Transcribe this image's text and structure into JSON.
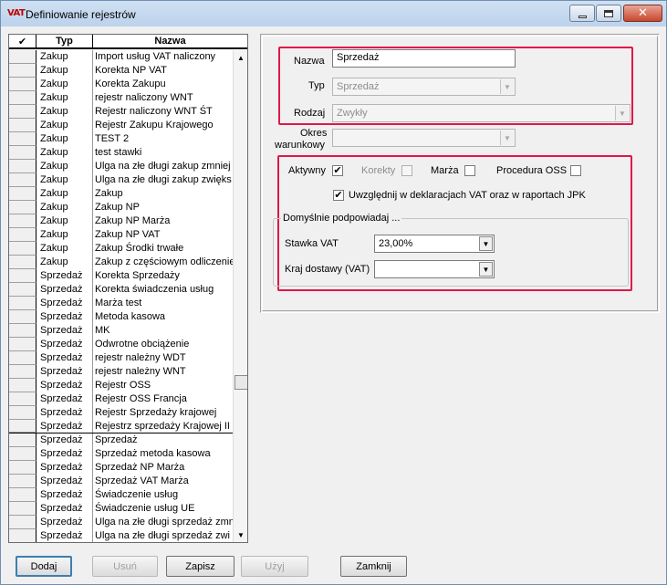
{
  "window": {
    "icon_text": "VAT",
    "title": "Definiowanie rejestrów"
  },
  "grid": {
    "headers": {
      "check": "✔",
      "typ": "Typ",
      "nazwa": "Nazwa"
    },
    "rows": [
      {
        "typ": "Zakup",
        "nazwa": "Import usług VAT naliczony"
      },
      {
        "typ": "Zakup",
        "nazwa": "Korekta NP VAT"
      },
      {
        "typ": "Zakup",
        "nazwa": "Korekta Zakupu"
      },
      {
        "typ": "Zakup",
        "nazwa": "rejestr naliczony WNT"
      },
      {
        "typ": "Zakup",
        "nazwa": "Rejestr naliczony WNT ŚT"
      },
      {
        "typ": "Zakup",
        "nazwa": "Rejestr Zakupu Krajowego"
      },
      {
        "typ": "Zakup",
        "nazwa": "TEST 2"
      },
      {
        "typ": "Zakup",
        "nazwa": "test stawki"
      },
      {
        "typ": "Zakup",
        "nazwa": "Ulga na złe długi zakup zmniej"
      },
      {
        "typ": "Zakup",
        "nazwa": "Ulga na złe długi zakup zwięks"
      },
      {
        "typ": "Zakup",
        "nazwa": "Zakup"
      },
      {
        "typ": "Zakup",
        "nazwa": "Zakup NP"
      },
      {
        "typ": "Zakup",
        "nazwa": "Zakup NP Marża"
      },
      {
        "typ": "Zakup",
        "nazwa": "Zakup NP VAT"
      },
      {
        "typ": "Zakup",
        "nazwa": "Zakup Środki trwałe"
      },
      {
        "typ": "Zakup",
        "nazwa": "Zakup z częściowym odliczenie"
      },
      {
        "typ": "Sprzedaż",
        "nazwa": "Korekta Sprzedaży"
      },
      {
        "typ": "Sprzedaż",
        "nazwa": "Korekta świadczenia usług"
      },
      {
        "typ": "Sprzedaż",
        "nazwa": "Marża test"
      },
      {
        "typ": "Sprzedaż",
        "nazwa": "Metoda kasowa"
      },
      {
        "typ": "Sprzedaż",
        "nazwa": "MK"
      },
      {
        "typ": "Sprzedaż",
        "nazwa": "Odwrotne obciążenie"
      },
      {
        "typ": "Sprzedaż",
        "nazwa": "rejestr należny WDT"
      },
      {
        "typ": "Sprzedaż",
        "nazwa": "rejestr należny WNT"
      },
      {
        "typ": "Sprzedaż",
        "nazwa": "Rejestr OSS"
      },
      {
        "typ": "Sprzedaż",
        "nazwa": "Rejestr OSS Francja"
      },
      {
        "typ": "Sprzedaż",
        "nazwa": "Rejestr Sprzedaży krajowej"
      },
      {
        "typ": "Sprzedaż",
        "nazwa": "Rejestrz sprzedaży Krajowej II"
      },
      {
        "typ": "Sprzedaż",
        "nazwa": "Sprzedaż"
      },
      {
        "typ": "Sprzedaż",
        "nazwa": "Sprzedaż metoda kasowa"
      },
      {
        "typ": "Sprzedaż",
        "nazwa": "Sprzedaż NP Marża"
      },
      {
        "typ": "Sprzedaż",
        "nazwa": "Sprzedaż VAT Marża"
      },
      {
        "typ": "Sprzedaż",
        "nazwa": "Świadczenie usług"
      },
      {
        "typ": "Sprzedaż",
        "nazwa": "Świadczenie usług UE"
      },
      {
        "typ": "Sprzedaż",
        "nazwa": "Ulga na złe długi sprzedaż zmn"
      },
      {
        "typ": "Sprzedaż",
        "nazwa": "Ulga na złe długi sprzedaż zwi"
      }
    ]
  },
  "form": {
    "nazwa_label": "Nazwa",
    "nazwa_value": "Sprzedaż",
    "typ_label": "Typ",
    "typ_value": "Sprzedaż",
    "rodzaj_label": "Rodzaj",
    "rodzaj_value": "Zwykły",
    "okres_label_1": "Okres",
    "okres_label_2": "warunkowy",
    "okres_value": "",
    "aktywny_label": "Aktywny",
    "aktywny_checked": "✔",
    "korekty_label": "Korekty",
    "marza_label": "Marża",
    "oss_label": "Procedura OSS",
    "jpk_label": "Uwzględnij w deklaracjach VAT oraz w raportach JPK",
    "jpk_checked": "✔",
    "group_title": "Domyślnie podpowiadaj ...",
    "stawka_label": "Stawka VAT",
    "stawka_value": "23,00%",
    "kraj_label": "Kraj dostawy (VAT)",
    "kraj_value": ""
  },
  "buttons": {
    "dodaj": "Dodaj",
    "usun": "Usuń",
    "zapisz": "Zapisz",
    "uzyj": "Użyj",
    "zamknij": "Zamknij"
  },
  "colors": {
    "highlight_border": "#e0174a",
    "title_bar": "#bcd2ec"
  }
}
